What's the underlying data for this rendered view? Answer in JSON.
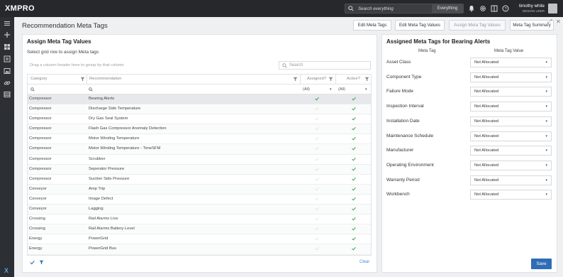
{
  "topbar": {
    "logo": "XMPRO",
    "search_placeholder": "Search everything",
    "search_scope": "Everything",
    "user_name": "timothy white",
    "user_role": "DESIGN USER"
  },
  "page": {
    "title": "Recommendation Meta Tags",
    "tabs": [
      "Edit Meta Tags",
      "Edit Meta Tag Values",
      "Assign Meta Tag Values",
      "Meta Tag Summary"
    ],
    "active_tab_index": 2
  },
  "left_panel": {
    "title": "Assign Meta Tag Values",
    "subtitle": "Select grid row to assign Meta tags",
    "drag_hint": "Drag a column header here to group by that column",
    "search_placeholder": "Search",
    "columns": [
      "Category",
      "Recommendation",
      "Assigned?",
      "Active?"
    ],
    "filter_all": "(All)",
    "clear_label": "Clear",
    "rows": [
      {
        "category": "Compressor",
        "recommendation": "Bearing Alerts",
        "assigned": true,
        "active": true,
        "selected": true
      },
      {
        "category": "Compressor",
        "recommendation": "Discharge Side Temperature",
        "assigned": false,
        "active": true
      },
      {
        "category": "Compressor",
        "recommendation": "Dry Gas Seal System",
        "assigned": false,
        "active": true
      },
      {
        "category": "Compressor",
        "recommendation": "Flash Gas Compressor Anomaly Detection",
        "assigned": false,
        "active": true
      },
      {
        "category": "Compressor",
        "recommendation": "Motor Winding Temperature",
        "assigned": false,
        "active": true
      },
      {
        "category": "Compressor",
        "recommendation": "Motor Winding Temperature - TimeSFM",
        "assigned": false,
        "active": true
      },
      {
        "category": "Compressor",
        "recommendation": "Scrubber",
        "assigned": false,
        "active": true
      },
      {
        "category": "Compressor",
        "recommendation": "Seperator Pressure",
        "assigned": false,
        "active": true
      },
      {
        "category": "Compressor",
        "recommendation": "Suction Side Pressure",
        "assigned": false,
        "active": true
      },
      {
        "category": "Conveyor",
        "recommendation": "Amp Trip",
        "assigned": false,
        "active": true
      },
      {
        "category": "Conveyor",
        "recommendation": "Image Defect",
        "assigned": false,
        "active": true
      },
      {
        "category": "Conveyor",
        "recommendation": "Lagging",
        "assigned": false,
        "active": true
      },
      {
        "category": "Crossing",
        "recommendation": "Rail Alarms Live",
        "assigned": false,
        "active": true
      },
      {
        "category": "Crossing",
        "recommendation": "Rail Alarms Battery Level",
        "assigned": false,
        "active": true
      },
      {
        "category": "Energy",
        "recommendation": "PowerGrid",
        "assigned": false,
        "active": true
      },
      {
        "category": "Energy",
        "recommendation": "PowerGrid Bus",
        "assigned": false,
        "active": true
      }
    ]
  },
  "right_panel": {
    "title": "Assigned Meta Tags for Bearing Alerts",
    "col_tag": "Meta Tag",
    "col_value": "Meta Tag Value",
    "tags": [
      {
        "name": "Asset Class",
        "value": "Not Allocated"
      },
      {
        "name": "Component Type",
        "value": "Not Allocated"
      },
      {
        "name": "Failure Mode",
        "value": "Not Allocated"
      },
      {
        "name": "Inspection Interval",
        "value": "Not Allocated"
      },
      {
        "name": "Installation Date",
        "value": "Not Allocated"
      },
      {
        "name": "Maintenance Schedule",
        "value": "Not Allocated"
      },
      {
        "name": "Manufacturer",
        "value": "Not Allocated"
      },
      {
        "name": "Operating Environment",
        "value": "Not Allocated"
      },
      {
        "name": "Warranty Period",
        "value": "Not Allocated"
      },
      {
        "name": "Workbench",
        "value": "Not Allocated"
      }
    ],
    "save_label": "Save"
  },
  "colors": {
    "topbar": "#26282b",
    "accent": "#2f6db5",
    "check": "#3a9a4a"
  }
}
